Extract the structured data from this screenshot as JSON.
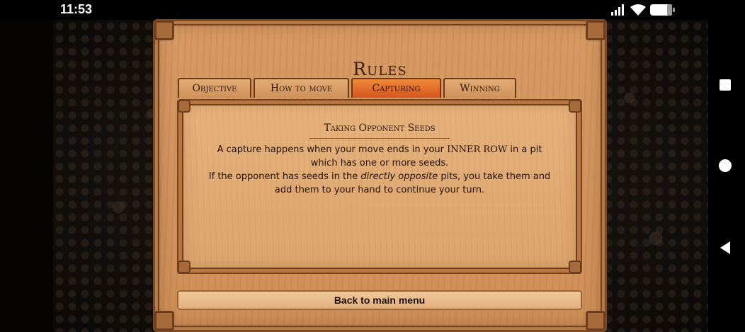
{
  "status_bar": {
    "time": "11:53"
  },
  "dialog": {
    "title": "Rules",
    "tabs": [
      {
        "label": "Objective"
      },
      {
        "label": "How to move"
      },
      {
        "label": "Capturing",
        "active": true
      },
      {
        "label": "Winning"
      }
    ],
    "section": {
      "title": "Taking Opponent Seeds",
      "line1_a": "A capture happens when your move ends in your ",
      "line1_caps": "INNER ROW",
      "line1_b": " in a pit",
      "line2": "which has one or more seeds.",
      "line3_a": "If the opponent has seeds in the ",
      "line3_em": "directly opposite",
      "line3_b": " pits, you take them and",
      "line4": "add them to your hand to continue your turn."
    },
    "back_label": "Back to main menu"
  },
  "icons": {
    "signal": "signal-icon",
    "wifi": "wifi-icon",
    "battery": "battery-icon",
    "nav_square": "recent-apps-icon",
    "nav_circle": "home-icon",
    "nav_triangle": "back-icon"
  },
  "colors": {
    "active_tab": "#e86a28",
    "panel_wood": "#d49760",
    "frame_dark": "#6d3f1f"
  }
}
